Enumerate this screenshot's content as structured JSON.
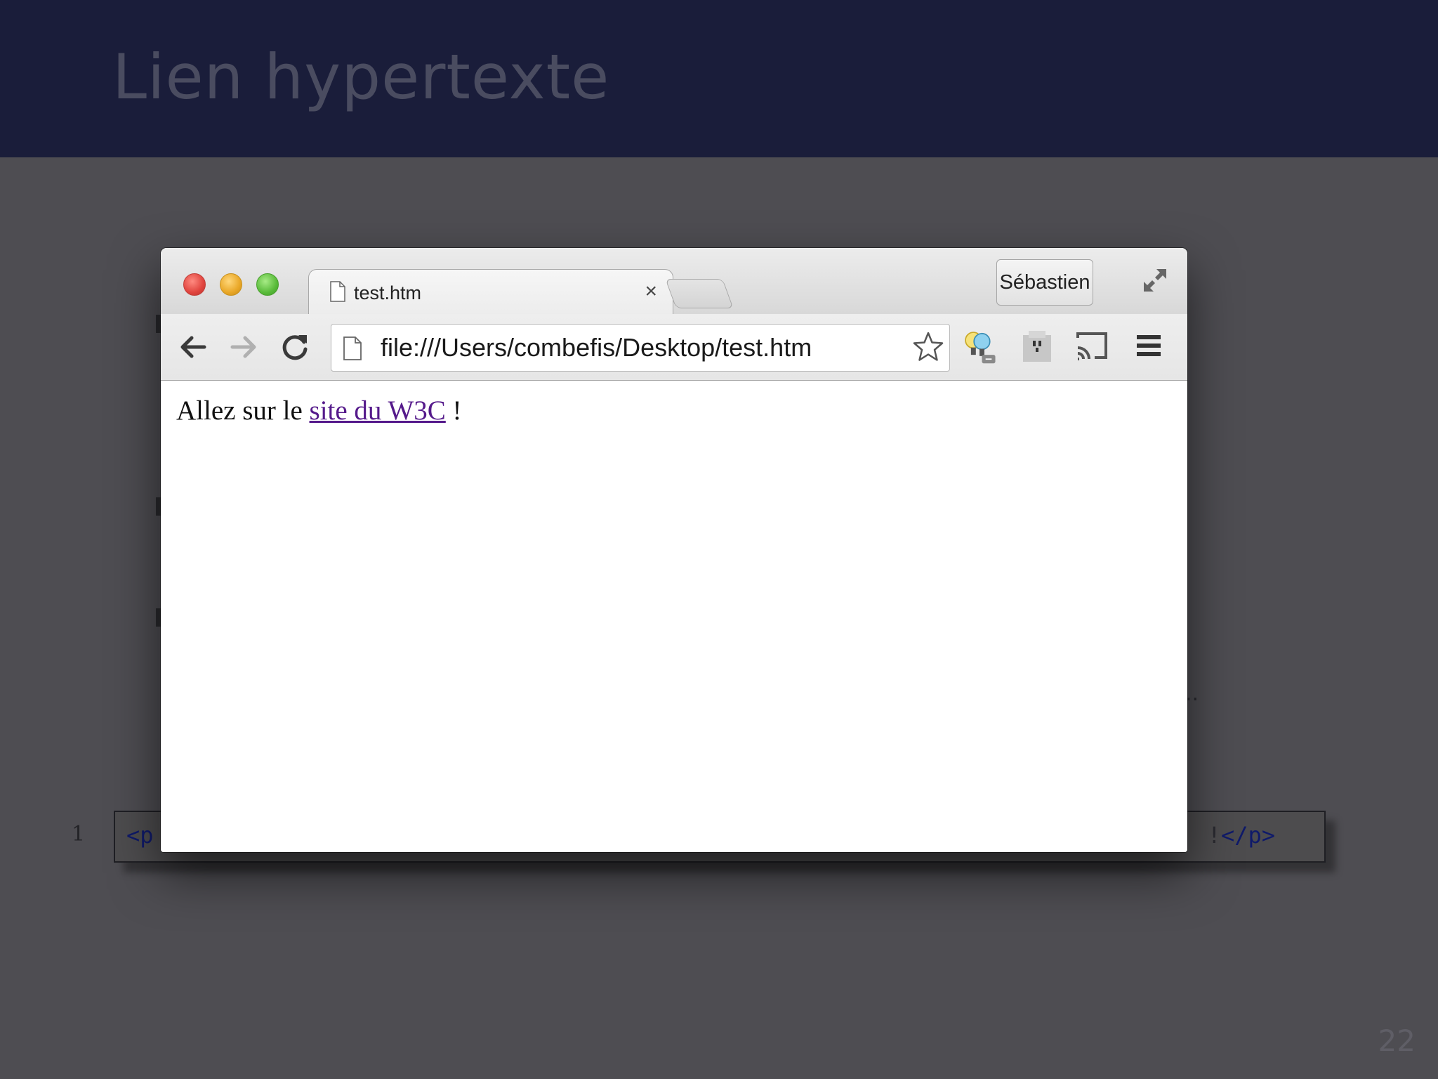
{
  "slide": {
    "title": "Lien hypertexte",
    "page_number": "22",
    "code_line_number": "1",
    "code_left": "<p",
    "code_right_excl": "!",
    "code_right_tag": "</p>",
    "ellipsis": ".."
  },
  "browser": {
    "tab_title": "test.htm",
    "tab_close": "×",
    "profile_name": "Sébastien",
    "url": "file:///Users/combefis/Desktop/test.htm",
    "content": {
      "before_link": "Allez sur le ",
      "link_text": "site du W3C",
      "after_link": " !"
    }
  },
  "icons": [
    "page-icon",
    "back-arrow-icon",
    "forward-arrow-icon",
    "reload-icon",
    "star-icon",
    "lightbulb-extension-icon",
    "evernote-extension-icon",
    "cast-icon",
    "menu-icon",
    "fullscreen-icon"
  ]
}
